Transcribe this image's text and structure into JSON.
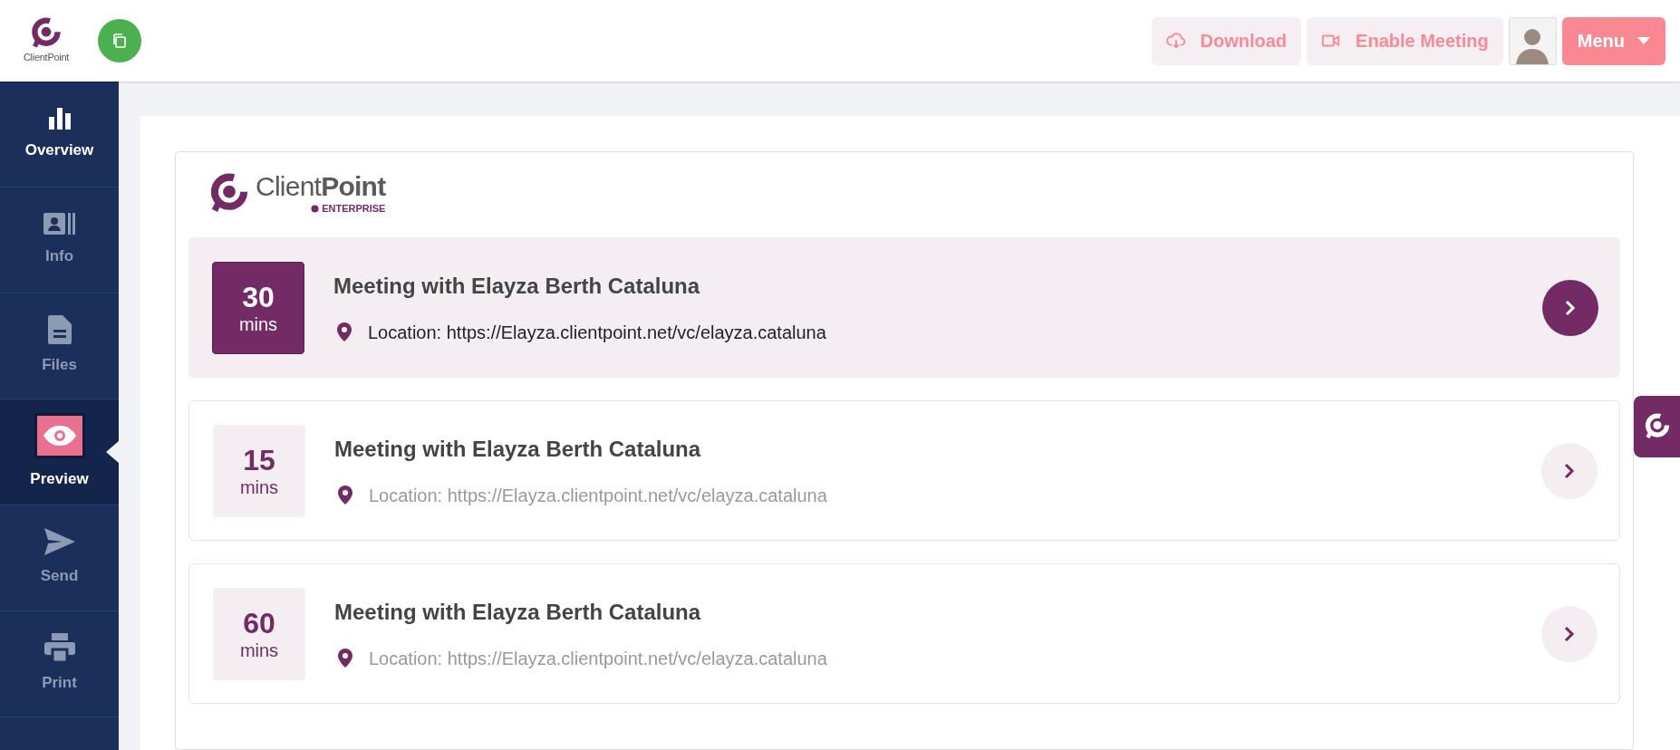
{
  "header": {
    "logo_text": "ClientPoint",
    "buttons": [
      {
        "kind": "download",
        "label": "Download"
      },
      {
        "kind": "meeting",
        "label": "Enable Meeting"
      }
    ],
    "menu": {
      "label": "Menu"
    }
  },
  "sidebar": {
    "items": [
      {
        "label": "Overview",
        "kind": "chart",
        "selected": false,
        "dimmed": false
      },
      {
        "label": "Info",
        "kind": "contact",
        "selected": false,
        "dimmed": true
      },
      {
        "label": "Files",
        "kind": "file",
        "selected": false,
        "dimmed": true
      },
      {
        "label": "Preview",
        "kind": "eye",
        "selected": true,
        "dimmed": false
      },
      {
        "label": "Send",
        "kind": "send",
        "selected": false,
        "dimmed": true
      },
      {
        "label": "Print",
        "kind": "print",
        "selected": false,
        "dimmed": true
      }
    ]
  },
  "brand": {
    "name_light": "Client",
    "name_bold": "Point",
    "edition": "ENTERPRISE"
  },
  "meetings": [
    {
      "minutes": "30",
      "unit": "mins",
      "title": "Meeting with Elayza Berth Cataluna",
      "location": "Location: https://Elayza.clientpoint.net/vc/elayza.cataluna",
      "selected": true
    },
    {
      "minutes": "15",
      "unit": "mins",
      "title": "Meeting with Elayza Berth Cataluna",
      "location": "Location: https://Elayza.clientpoint.net/vc/elayza.cataluna",
      "selected": false
    },
    {
      "minutes": "60",
      "unit": "mins",
      "title": "Meeting with Elayza Berth Cataluna",
      "location": "Location: https://Elayza.clientpoint.net/vc/elayza.cataluna",
      "selected": false
    }
  ]
}
